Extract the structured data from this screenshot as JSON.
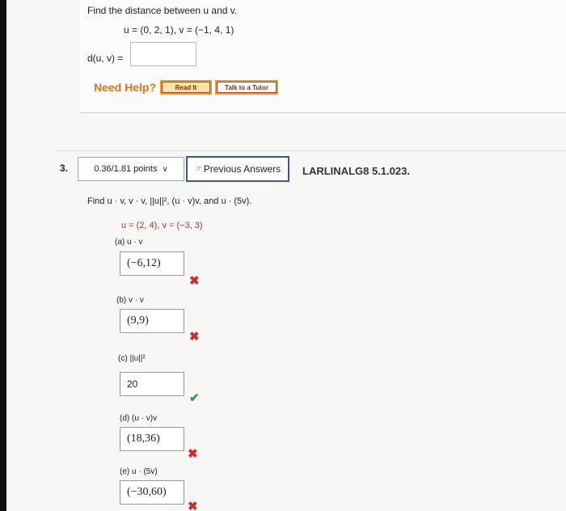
{
  "top_problem": {
    "question": "Find the distance between u and v.",
    "vectors": "u = (0, 2, 1),   v = (−1, 4, 1)",
    "distance_label": "d(u, v) =",
    "answer": "",
    "need_help": "Need Help?",
    "read_it": "Read It",
    "talk_tutor": "Talk to a Tutor"
  },
  "question3": {
    "number": "3.",
    "points": "0.36/1.81 points",
    "previous_answers": "Previous Answers",
    "code": "LARLINALG8 5.1.023.",
    "prompt": "Find u · v, v · v, ||u||², (u · v)v, and u · (5v).",
    "vectors": "u = (2, 4),   v = (−3, 3)",
    "parts": [
      {
        "label": "(a)   u · v",
        "answer": "(−6,12)",
        "status": "wrong"
      },
      {
        "label": "(b)   v · v",
        "answer": "(9,9)",
        "status": "wrong"
      },
      {
        "label": "(c)   ||u||²",
        "answer": "20",
        "status": "correct"
      },
      {
        "label": "(d)   (u · v)v",
        "answer": "(18,36)",
        "status": "wrong"
      },
      {
        "label": "(e)   u · (5v)",
        "answer": "(−30,60)",
        "status": "wrong"
      }
    ]
  },
  "icons": {
    "wrong": "✖",
    "correct": "✔",
    "chevron": "chevron-down-icon",
    "previous": "hand-cursor-icon"
  },
  "colors": {
    "help_orange": "#d9741b",
    "wrong_red": "#d02a2a",
    "correct_green": "#2f9a3a",
    "button_border": "#3a5890"
  }
}
